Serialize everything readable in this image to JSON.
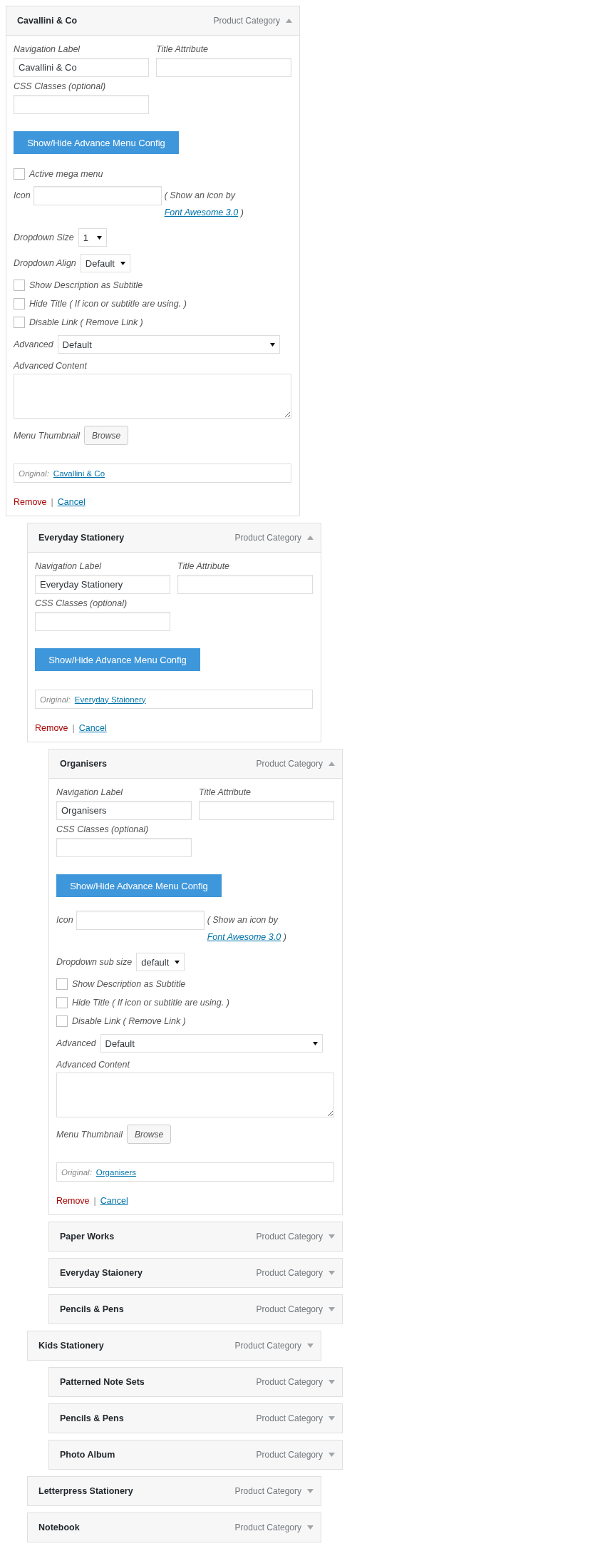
{
  "menu_items": [
    {
      "title": "Cavallini & Co",
      "type": "Product Category",
      "expanded": true,
      "settings": {
        "navigation_label": {
          "label": "Navigation Label",
          "value": "Cavallini & Co"
        },
        "title_attribute": {
          "label": "Title Attribute"
        },
        "css_classes": {
          "label": "CSS Classes (optional)"
        },
        "toggle_button": "Show/Hide Advance Menu Config",
        "advanced": [
          {
            "kind": "checkbox",
            "label": "Active mega menu",
            "checked": false
          },
          {
            "kind": "icon",
            "label": "Icon",
            "note": "( Show an icon by ",
            "link": "Font Awesome 3.0",
            "note_end": " )"
          },
          {
            "kind": "select",
            "label": "Dropdown Size",
            "value": "1"
          },
          {
            "kind": "select",
            "label": "Dropdown Align",
            "value": "Default"
          },
          {
            "kind": "checkbox",
            "label": "Show Description as Subtitle",
            "checked": false
          },
          {
            "kind": "checkbox",
            "label": "Hide Title ( If icon or subtitle are using. )",
            "checked": false
          },
          {
            "kind": "checkbox",
            "label": "Disable Link ( Remove Link )",
            "checked": false
          },
          {
            "kind": "wide_select",
            "label": "Advanced",
            "value": "Default"
          },
          {
            "kind": "textarea",
            "label": "Advanced Content"
          },
          {
            "kind": "thumbnail",
            "label": "Menu Thumbnail",
            "button": "Browse"
          }
        ],
        "original": {
          "label": "Original:",
          "link": "Cavallini & Co"
        },
        "remove": "Remove",
        "separator": "|",
        "cancel": "Cancel"
      },
      "children": [
        {
          "title": "Everyday Stationery",
          "type": "Product Category",
          "expanded": true,
          "settings": {
            "navigation_label": {
              "label": "Navigation Label",
              "value": "Everyday Stationery"
            },
            "title_attribute": {
              "label": "Title Attribute"
            },
            "css_classes": {
              "label": "CSS Classes (optional)"
            },
            "toggle_button": "Show/Hide Advance Menu Config",
            "original": {
              "label": "Original:",
              "link": "Everyday Staionery"
            },
            "remove": "Remove",
            "separator": "|",
            "cancel": "Cancel"
          },
          "children": [
            {
              "title": "Organisers",
              "type": "Product Category",
              "expanded": true,
              "settings": {
                "navigation_label": {
                  "label": "Navigation Label",
                  "value": "Organisers"
                },
                "title_attribute": {
                  "label": "Title Attribute"
                },
                "css_classes": {
                  "label": "CSS Classes (optional)"
                },
                "toggle_button": "Show/Hide Advance Menu Config",
                "advanced": [
                  {
                    "kind": "icon",
                    "label": "Icon",
                    "note": "( Show an icon by ",
                    "link": "Font Awesome 3.0",
                    "note_end": " )"
                  },
                  {
                    "kind": "select",
                    "label": "Dropdown sub size",
                    "value": "default"
                  },
                  {
                    "kind": "checkbox",
                    "label": "Show Description as Subtitle",
                    "checked": false
                  },
                  {
                    "kind": "checkbox",
                    "label": "Hide Title ( If icon or subtitle are using. )",
                    "checked": false
                  },
                  {
                    "kind": "checkbox",
                    "label": "Disable Link ( Remove Link )",
                    "checked": false
                  },
                  {
                    "kind": "wide_select",
                    "label": "Advanced",
                    "value": "Default"
                  },
                  {
                    "kind": "textarea",
                    "label": "Advanced Content"
                  },
                  {
                    "kind": "thumbnail",
                    "label": "Menu Thumbnail",
                    "button": "Browse"
                  }
                ],
                "original": {
                  "label": "Original:",
                  "link": "Organisers"
                },
                "remove": "Remove",
                "separator": "|",
                "cancel": "Cancel"
              }
            },
            {
              "title": "Paper Works",
              "type": "Product Category",
              "expanded": false
            },
            {
              "title": "Everyday Staionery",
              "type": "Product Category",
              "expanded": false
            },
            {
              "title": "Pencils & Pens",
              "type": "Product Category",
              "expanded": false
            }
          ]
        },
        {
          "title": "Kids Stationery",
          "type": "Product Category",
          "expanded": false,
          "children": [
            {
              "title": "Patterned Note Sets",
              "type": "Product Category",
              "expanded": false
            },
            {
              "title": "Pencils & Pens",
              "type": "Product Category",
              "expanded": false
            },
            {
              "title": "Photo Album",
              "type": "Product Category",
              "expanded": false
            }
          ]
        },
        {
          "title": "Letterpress Stationery",
          "type": "Product Category",
          "expanded": false
        },
        {
          "title": "Notebook",
          "type": "Product Category",
          "expanded": false
        }
      ]
    }
  ]
}
